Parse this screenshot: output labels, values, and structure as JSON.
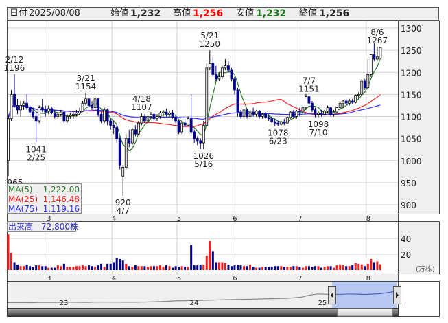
{
  "header": {
    "date_label": "日付",
    "date": "2025/08/08",
    "open_label": "始値",
    "open": "1,232",
    "high_label": "高値",
    "high": "1,256",
    "low_label": "安値",
    "low": "1,232",
    "close_label": "終値",
    "close": "1,256"
  },
  "colors": {
    "up_volume": "#ff1a1a",
    "down_volume": "#00008b",
    "flat_volume": "#888888",
    "ma5": "#2a7a2a",
    "ma25": "#ff2020",
    "ma75": "#3030ff",
    "high_text": "#ff0000",
    "low_text": "#1a7a1a"
  },
  "legend": {
    "ma5_label": "MA(5)",
    "ma5_value": "1,222.00",
    "ma25_label": "MA(25)",
    "ma25_value": "1,146.48",
    "ma75_label": "MA(75)",
    "ma75_value": "1,119.16"
  },
  "volume_label": "出来高　72,800株",
  "volume_unit": "(万株)",
  "chart_data": {
    "type": "candlestick",
    "title": "",
    "ylim": [
      880,
      1310
    ],
    "yticks": [
      "1300",
      "1250",
      "1200",
      "1150",
      "1100",
      "1050",
      "1000",
      "950",
      "900"
    ],
    "ytick_values": [
      1300,
      1250,
      1200,
      1150,
      1100,
      1050,
      1000,
      950,
      900
    ],
    "month_labels": [
      "3",
      "4",
      "5",
      "6",
      "7",
      "8"
    ],
    "month_start_index": [
      13,
      34,
      55,
      73,
      94,
      116
    ],
    "volume_ylim": [
      0,
      45
    ],
    "volume_ticks": [
      "40",
      "20"
    ],
    "volume_tick_values": [
      40,
      20
    ],
    "ma_periods": [
      5,
      25,
      75
    ],
    "ohlcv": [
      [
        1000,
        1105,
        965,
        1095,
        45
      ],
      [
        1095,
        1160,
        1090,
        1150,
        22
      ],
      [
        1150,
        1196,
        1120,
        1125,
        10
      ],
      [
        1125,
        1140,
        1105,
        1115,
        7
      ],
      [
        1115,
        1135,
        1100,
        1125,
        5
      ],
      [
        1125,
        1135,
        1115,
        1130,
        5
      ],
      [
        1130,
        1150,
        1115,
        1120,
        7
      ],
      [
        1120,
        1125,
        1100,
        1110,
        5
      ],
      [
        1110,
        1120,
        1095,
        1100,
        4
      ],
      [
        1100,
        1112,
        1041,
        1090,
        6
      ],
      [
        1090,
        1125,
        1085,
        1120,
        6
      ],
      [
        1120,
        1140,
        1110,
        1115,
        5
      ],
      [
        1115,
        1125,
        1100,
        1110,
        5
      ],
      [
        1112,
        1125,
        1105,
        1118,
        3
      ],
      [
        1118,
        1122,
        1105,
        1108,
        3
      ],
      [
        1108,
        1115,
        1095,
        1100,
        3
      ],
      [
        1100,
        1110,
        1095,
        1105,
        6
      ],
      [
        1105,
        1115,
        1100,
        1110,
        5
      ],
      [
        1110,
        1112,
        1085,
        1090,
        8
      ],
      [
        1090,
        1105,
        1085,
        1100,
        4
      ],
      [
        1100,
        1108,
        1095,
        1102,
        4
      ],
      [
        1102,
        1110,
        1095,
        1105,
        4
      ],
      [
        1105,
        1115,
        1100,
        1108,
        5
      ],
      [
        1108,
        1120,
        1103,
        1112,
        5
      ],
      [
        1112,
        1135,
        1110,
        1130,
        6
      ],
      [
        1130,
        1154,
        1125,
        1140,
        5
      ],
      [
        1140,
        1145,
        1120,
        1125,
        6
      ],
      [
        1125,
        1135,
        1115,
        1120,
        5
      ],
      [
        1120,
        1145,
        1118,
        1140,
        4
      ],
      [
        1140,
        1142,
        1100,
        1105,
        6
      ],
      [
        1105,
        1110,
        1085,
        1090,
        8
      ],
      [
        1090,
        1120,
        1085,
        1115,
        4
      ],
      [
        1115,
        1118,
        1080,
        1090,
        8
      ],
      [
        1090,
        1095,
        1070,
        1080,
        8
      ],
      [
        1080,
        1090,
        1060,
        1075,
        10
      ],
      [
        1075,
        1080,
        1040,
        1050,
        15
      ],
      [
        1050,
        1055,
        980,
        990,
        14
      ],
      [
        965,
        990,
        920,
        985,
        12
      ],
      [
        985,
        1060,
        980,
        1050,
        8
      ],
      [
        1050,
        1070,
        1030,
        1040,
        5
      ],
      [
        1040,
        1075,
        1035,
        1070,
        4
      ],
      [
        1070,
        1080,
        1055,
        1060,
        6
      ],
      [
        1060,
        1090,
        1058,
        1085,
        5
      ],
      [
        1085,
        1107,
        1080,
        1100,
        5
      ],
      [
        1100,
        1105,
        1085,
        1090,
        5
      ],
      [
        1090,
        1105,
        1085,
        1100,
        4
      ],
      [
        1100,
        1110,
        1095,
        1105,
        5
      ],
      [
        1105,
        1108,
        1090,
        1095,
        5
      ],
      [
        1095,
        1105,
        1090,
        1100,
        5
      ],
      [
        1100,
        1112,
        1095,
        1108,
        6
      ],
      [
        1108,
        1115,
        1100,
        1110,
        4
      ],
      [
        1110,
        1118,
        1100,
        1105,
        6
      ],
      [
        1105,
        1112,
        1100,
        1108,
        5
      ],
      [
        1108,
        1115,
        1095,
        1098,
        3
      ],
      [
        1098,
        1102,
        1085,
        1090,
        5
      ],
      [
        1090,
        1092,
        1060,
        1065,
        4
      ],
      [
        1065,
        1090,
        1060,
        1085,
        5
      ],
      [
        1085,
        1095,
        1075,
        1080,
        4
      ],
      [
        1080,
        1100,
        1078,
        1095,
        4
      ],
      [
        1095,
        1150,
        1060,
        1065,
        32
      ],
      [
        1065,
        1070,
        1040,
        1050,
        6
      ],
      [
        1050,
        1055,
        1035,
        1045,
        6
      ],
      [
        1045,
        1050,
        1026,
        1040,
        7
      ],
      [
        1040,
        1090,
        1026,
        1080,
        7
      ],
      [
        1080,
        1220,
        1075,
        1210,
        18
      ],
      [
        1210,
        1250,
        1205,
        1220,
        37
      ],
      [
        1220,
        1235,
        1190,
        1195,
        24
      ],
      [
        1195,
        1215,
        1180,
        1185,
        10
      ],
      [
        1185,
        1200,
        1180,
        1190,
        10
      ],
      [
        1190,
        1215,
        1185,
        1210,
        10
      ],
      [
        1210,
        1230,
        1205,
        1215,
        9
      ],
      [
        1215,
        1225,
        1200,
        1205,
        7
      ],
      [
        1205,
        1210,
        1180,
        1185,
        5
      ],
      [
        1185,
        1190,
        1150,
        1160,
        6
      ],
      [
        1160,
        1165,
        1100,
        1110,
        7
      ],
      [
        1110,
        1115,
        1095,
        1100,
        6
      ],
      [
        1100,
        1120,
        1095,
        1115,
        5
      ],
      [
        1115,
        1118,
        1095,
        1100,
        5
      ],
      [
        1100,
        1115,
        1095,
        1110,
        7
      ],
      [
        1110,
        1120,
        1100,
        1105,
        4
      ],
      [
        1105,
        1115,
        1100,
        1112,
        3
      ],
      [
        1112,
        1115,
        1095,
        1100,
        3
      ],
      [
        1100,
        1108,
        1095,
        1105,
        4
      ],
      [
        1105,
        1110,
        1095,
        1098,
        4
      ],
      [
        1098,
        1105,
        1090,
        1095,
        4
      ],
      [
        1095,
        1100,
        1085,
        1088,
        4
      ],
      [
        1088,
        1095,
        1078,
        1085,
        5
      ],
      [
        1085,
        1090,
        1078,
        1082,
        5
      ],
      [
        1082,
        1090,
        1078,
        1088,
        5
      ],
      [
        1088,
        1095,
        1080,
        1085,
        4
      ],
      [
        1085,
        1100,
        1083,
        1098,
        4
      ],
      [
        1098,
        1112,
        1095,
        1110,
        4
      ],
      [
        1110,
        1115,
        1095,
        1100,
        5
      ],
      [
        1100,
        1115,
        1095,
        1112,
        5
      ],
      [
        1112,
        1120,
        1100,
        1110,
        4
      ],
      [
        1110,
        1125,
        1105,
        1120,
        3
      ],
      [
        1120,
        1151,
        1115,
        1145,
        5
      ],
      [
        1145,
        1148,
        1125,
        1130,
        5
      ],
      [
        1130,
        1135,
        1110,
        1115,
        4
      ],
      [
        1115,
        1120,
        1098,
        1105,
        5
      ],
      [
        1105,
        1112,
        1098,
        1108,
        5
      ],
      [
        1108,
        1115,
        1100,
        1105,
        3
      ],
      [
        1105,
        1115,
        1102,
        1112,
        4
      ],
      [
        1112,
        1125,
        1108,
        1120,
        5
      ],
      [
        1120,
        1122,
        1100,
        1105,
        5
      ],
      [
        1105,
        1115,
        1100,
        1110,
        3
      ],
      [
        1110,
        1122,
        1108,
        1120,
        6
      ],
      [
        1120,
        1135,
        1115,
        1130,
        7
      ],
      [
        1130,
        1138,
        1120,
        1135,
        6
      ],
      [
        1135,
        1140,
        1125,
        1130,
        5
      ],
      [
        1130,
        1140,
        1125,
        1135,
        5
      ],
      [
        1135,
        1140,
        1128,
        1132,
        6
      ],
      [
        1132,
        1150,
        1130,
        1148,
        9
      ],
      [
        1148,
        1155,
        1140,
        1150,
        8
      ],
      [
        1150,
        1185,
        1145,
        1180,
        7
      ],
      [
        1180,
        1185,
        1160,
        1165,
        5
      ],
      [
        1165,
        1230,
        1160,
        1195,
        8
      ],
      [
        1195,
        1240,
        1190,
        1240,
        14
      ],
      [
        1240,
        1267,
        1225,
        1230,
        10
      ],
      [
        1230,
        1258,
        1225,
        1235,
        11
      ],
      [
        1232,
        1256,
        1232,
        1256,
        7.28
      ]
    ],
    "annotations": [
      {
        "index": 2,
        "date": "2/12",
        "value": "1196",
        "pos": "above"
      },
      {
        "index": 9,
        "date": "2/25",
        "value": "1041",
        "pos": "below"
      },
      {
        "index": 25,
        "date": "3/21",
        "value": "1154",
        "pos": "above"
      },
      {
        "index": 37,
        "date": "4/7",
        "value": "920",
        "pos": "below"
      },
      {
        "index": 43,
        "date": "4/18",
        "value": "1107",
        "pos": "above"
      },
      {
        "index": 63,
        "date": "5/16",
        "value": "1026",
        "pos": "below"
      },
      {
        "index": 65,
        "date": "5/21",
        "value": "1250",
        "pos": "above"
      },
      {
        "index": 87,
        "date": "6/23",
        "value": "1078",
        "pos": "below"
      },
      {
        "index": 97,
        "date": "7/7",
        "value": "1151",
        "pos": "above"
      },
      {
        "index": 100,
        "date": "7/10",
        "value": "1098",
        "pos": "below"
      },
      {
        "index": 0,
        "date": "",
        "value": "965",
        "pos": "below"
      },
      {
        "index": 119,
        "date": "8/6",
        "value": "1267",
        "pos": "above"
      }
    ],
    "navigator": {
      "year_labels": [
        "23",
        "24",
        "25"
      ],
      "values": [
        760,
        760,
        762,
        758,
        765,
        768,
        770,
        772,
        775,
        772,
        770,
        778,
        780,
        778,
        776,
        774,
        775,
        780,
        790,
        800,
        810,
        830,
        840,
        845,
        850,
        860,
        870,
        880,
        885,
        895,
        900,
        905,
        915,
        925,
        930,
        940,
        960,
        990,
        1070,
        1120,
        1110,
        1100,
        1105,
        1120,
        1110,
        1100,
        1115,
        1130,
        1180,
        1240
      ]
    }
  }
}
